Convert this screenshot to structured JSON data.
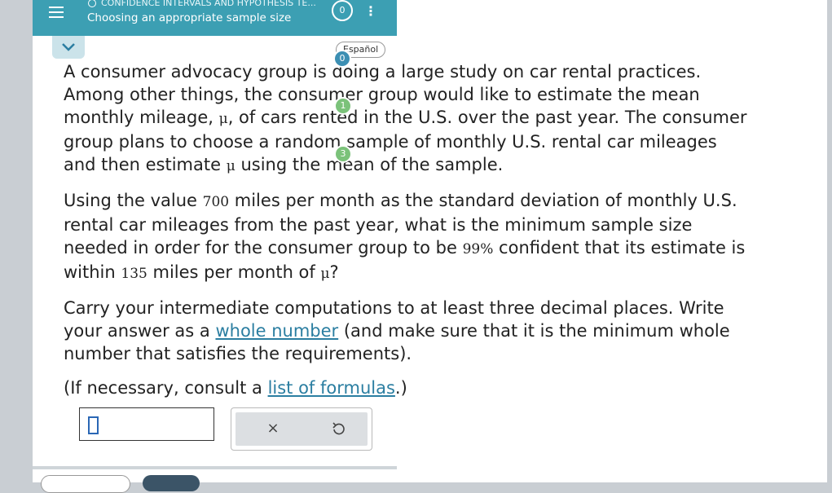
{
  "header": {
    "topic": "CONFIDENCE INTERVALS AND HYPOTHESIS TE...",
    "title": "Choosing an appropriate sample size",
    "progress": "0"
  },
  "language_label": "Español",
  "badges": [
    "0",
    "1",
    "3"
  ],
  "question": {
    "p1": {
      "text_a": "A consumer advocacy group is doing a large study on car rental practices. Among other things, the consumer group would like to estimate the mean monthly mileage, ",
      "mu1": "μ",
      "text_b": ", of cars rented in the U.S. over the past year. The consumer group plans to choose a random sample of monthly U.S. rental car mileages and then estimate ",
      "mu2": "μ",
      "text_c": " using the mean of the sample."
    },
    "p2": {
      "text_a": "Using the value ",
      "sd": "700",
      "text_b": " miles per month as the standard deviation of monthly U.S. rental car mileages from the past year, what is the minimum sample size needed in order for the consumer group to be ",
      "conf": "99%",
      "text_c": " confident that its estimate is within ",
      "margin": "135",
      "text_d": " miles per month of ",
      "mu": "μ",
      "text_e": "?"
    },
    "p3": {
      "text_a": "Carry your intermediate computations to at least three decimal places. Write your answer as a ",
      "link": "whole number",
      "text_b": " (and make sure that it is the minimum whole number that satisfies the requirements)."
    },
    "p4": {
      "text_a": "(If necessary, consult a ",
      "link": "list of formulas",
      "text_b": ".)"
    }
  },
  "tools": {
    "clear": "×"
  },
  "colors": {
    "header": "#3c9fb3",
    "link": "#2b7ea1",
    "badge_blue": "#3c8fb3",
    "badge_green": "#7bc27a"
  }
}
